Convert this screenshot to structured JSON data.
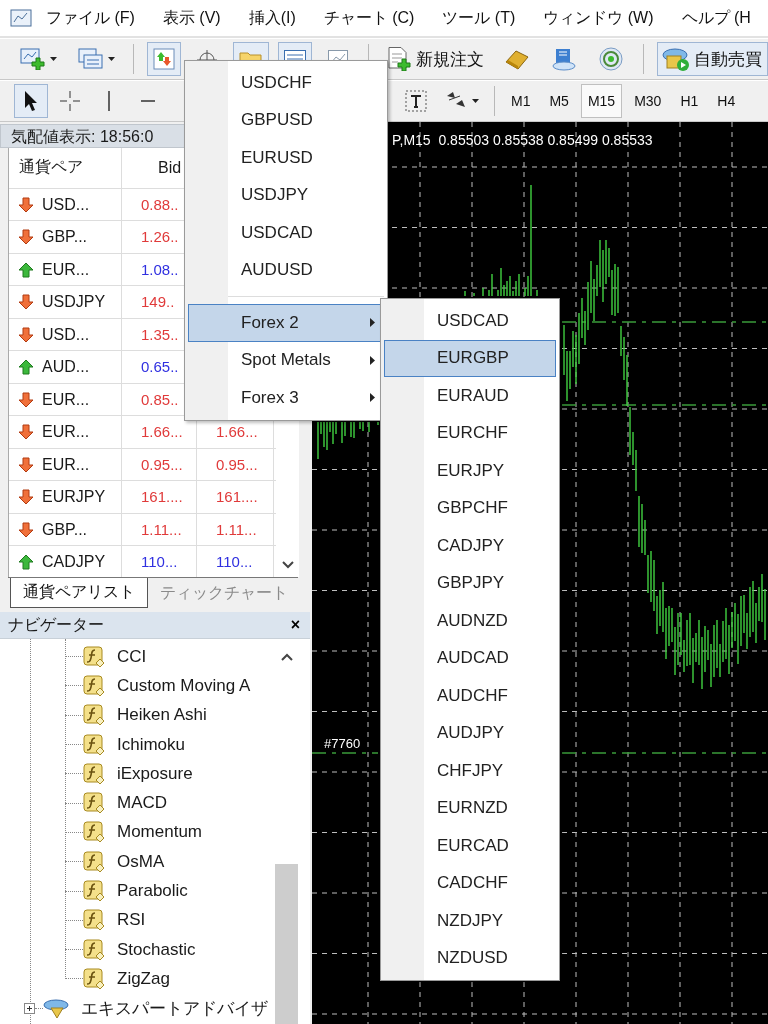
{
  "menu_bar": {
    "items": [
      "ファイル (F)",
      "表示 (V)",
      "挿入(I)",
      "チャート (C)",
      "ツール (T)",
      "ウィンドウ (W)",
      "ヘルプ (H"
    ]
  },
  "toolbar_1": {
    "tools": [
      {
        "kind": "new-chart",
        "pressed": false
      },
      {
        "kind": "profiles",
        "pressed": false
      },
      {
        "kind": "separator"
      },
      {
        "kind": "market-watch",
        "pressed": true
      },
      {
        "kind": "data-window",
        "pressed": false
      },
      {
        "kind": "navigator",
        "pressed": true
      },
      {
        "kind": "terminal",
        "pressed": true
      },
      {
        "kind": "tester",
        "pressed": false
      },
      {
        "kind": "separator"
      },
      {
        "kind": "new-order",
        "label": "新規注文",
        "pressed": false
      },
      {
        "kind": "market",
        "pressed": false
      },
      {
        "kind": "library",
        "pressed": false
      },
      {
        "kind": "signals",
        "pressed": false
      },
      {
        "kind": "separator"
      },
      {
        "kind": "auto-trading",
        "label": "自動売買",
        "pressed": true
      }
    ]
  },
  "toolbar_2": {
    "tools": [
      {
        "kind": "cursor",
        "pressed": true
      },
      {
        "kind": "crosshair",
        "pressed": false
      },
      {
        "kind": "vertical-line",
        "pressed": false
      },
      {
        "kind": "horizontal-line",
        "pressed": false
      },
      {
        "kind": "gap"
      },
      {
        "kind": "text-label",
        "pressed": false
      },
      {
        "kind": "shapes",
        "pressed": false
      },
      {
        "kind": "separator"
      }
    ],
    "timeframes": [
      {
        "label": "M1",
        "selected": false
      },
      {
        "label": "M5",
        "selected": false
      },
      {
        "label": "M15",
        "selected": true
      },
      {
        "label": "M30",
        "selected": false
      },
      {
        "label": "H1",
        "selected": false
      },
      {
        "label": "H4",
        "selected": false
      }
    ]
  },
  "market_watch": {
    "title": "気配値表示: 18:56:0",
    "columns": [
      "通貨ペア",
      "Bid"
    ],
    "rows": [
      {
        "rising": false,
        "symbol": "USD...",
        "bid": "0.88.."
      },
      {
        "rising": false,
        "symbol": "GBP...",
        "bid": "1.26.."
      },
      {
        "rising": true,
        "symbol": "EUR...",
        "bid": "1.08.."
      },
      {
        "rising": false,
        "symbol": "USDJPY",
        "bid": "149.."
      },
      {
        "rising": false,
        "symbol": "USD...",
        "bid": "1.35.."
      },
      {
        "rising": true,
        "symbol": "AUD...",
        "bid": "0.65.."
      },
      {
        "rising": false,
        "symbol": "EUR...",
        "bid": "0.85.."
      },
      {
        "rising": false,
        "symbol": "EUR...",
        "bid": "1.66...",
        "ask": "1.66..."
      },
      {
        "rising": false,
        "symbol": "EUR...",
        "bid": "0.95...",
        "ask": "0.95..."
      },
      {
        "rising": false,
        "symbol": "EURJPY",
        "bid": "161....",
        "ask": "161...."
      },
      {
        "rising": false,
        "symbol": "GBP...",
        "bid": "1.11...",
        "ask": "1.11..."
      },
      {
        "rising": true,
        "symbol": "CADJPY",
        "bid": "110...",
        "ask": "110..."
      }
    ],
    "tabs": [
      {
        "label": "通貨ペアリスト",
        "selected": true
      },
      {
        "label": "ティックチャート",
        "selected": false
      }
    ]
  },
  "navigator": {
    "title": "ナビゲーター",
    "close": "×",
    "indicators": [
      "CCI",
      "Custom Moving A",
      "Heiken Ashi",
      "Ichimoku",
      "iExposure",
      "MACD",
      "Momentum",
      "OsMA",
      "Parabolic",
      "RSI",
      "Stochastic",
      "ZigZag"
    ],
    "expert_advisors": {
      "label": "エキスパートアドバイザ",
      "expanded": false
    }
  },
  "chart": {
    "title": "P,M15  0.85503 0.85538 0.85499 0.85533",
    "order_label": "#7760"
  },
  "symbol_menu": {
    "items": [
      {
        "kind": "symbol",
        "label": "USDCHF",
        "selected": false
      },
      {
        "kind": "symbol",
        "label": "GBPUSD",
        "selected": false
      },
      {
        "kind": "symbol",
        "label": "EURUSD",
        "selected": false
      },
      {
        "kind": "symbol",
        "label": "USDJPY",
        "selected": false
      },
      {
        "kind": "symbol",
        "label": "USDCAD",
        "selected": false
      },
      {
        "kind": "symbol",
        "label": "AUDUSD",
        "selected": false
      },
      {
        "kind": "separator"
      },
      {
        "kind": "submenu",
        "label": "Forex 2",
        "selected": true
      },
      {
        "kind": "submenu",
        "label": "Spot Metals",
        "selected": false
      },
      {
        "kind": "submenu",
        "label": "Forex 3",
        "selected": false
      }
    ]
  },
  "forex_2_menu": {
    "items": [
      {
        "label": "USDCAD",
        "selected": false
      },
      {
        "label": "EURGBP",
        "selected": true
      },
      {
        "label": "EURAUD",
        "selected": false
      },
      {
        "label": "EURCHF",
        "selected": false
      },
      {
        "label": "EURJPY",
        "selected": false
      },
      {
        "label": "GBPCHF",
        "selected": false
      },
      {
        "label": "CADJPY",
        "selected": false
      },
      {
        "label": "GBPJPY",
        "selected": false
      },
      {
        "label": "AUDNZD",
        "selected": false
      },
      {
        "label": "AUDCAD",
        "selected": false
      },
      {
        "label": "AUDCHF",
        "selected": false
      },
      {
        "label": "AUDJPY",
        "selected": false
      },
      {
        "label": "CHFJPY",
        "selected": false
      },
      {
        "label": "EURNZD",
        "selected": false
      },
      {
        "label": "EURCAD",
        "selected": false
      },
      {
        "label": "CADCHF",
        "selected": false
      },
      {
        "label": "NZDJPY",
        "selected": false
      },
      {
        "label": "NZDUSD",
        "selected": false
      }
    ]
  }
}
